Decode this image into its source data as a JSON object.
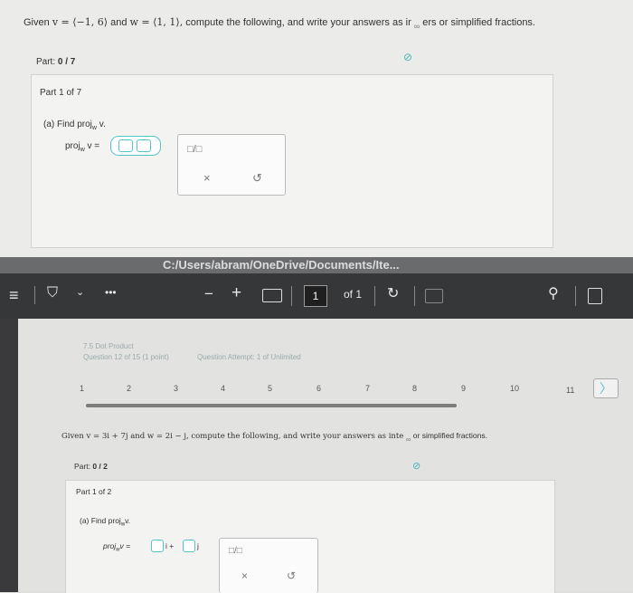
{
  "top": {
    "question_pre": "Given",
    "question_v": "v = ⟨−1, 6⟩",
    "question_and": "and",
    "question_w": "w = ⟨1, 1⟩,",
    "question_post": "compute the following, and write your answers as ir",
    "question_tail": "ers or simplified fractions.",
    "infinity": "∞",
    "part_label": "Part:",
    "part_value": "0 / 7",
    "part_of": "Part 1 of 7",
    "sub_a": "(a) Find proj",
    "sub_a_sub": "w",
    "sub_a_end": " v.",
    "proj_label": "proj",
    "proj_sub": "w",
    "proj_end": " v =",
    "frac_symbol": "□/□",
    "x_symbol": "×",
    "undo_symbol": "↺"
  },
  "band_text": "C:/Users/abram/OneDrive/Documents/Ite...",
  "toolbar": {
    "menu_icon": "≡",
    "minus": "−",
    "plus": "+",
    "page_current": "1",
    "page_of": "of 1",
    "dots": "•••"
  },
  "lower": {
    "crumb_title": "7.5 Dot Product",
    "crumb_question": "Question 12 of 15 (1 point)",
    "crumb_attempt": "Question Attempt: 1 of Unlimited",
    "pages": [
      "1",
      "2",
      "3",
      "4",
      "5",
      "6",
      "7",
      "8",
      "9",
      "10",
      "11"
    ],
    "question": "Given v = 3i + 7j and w = 2i − j, compute the following, and write your answers as inte",
    "question_tail": "or simplified fractions.",
    "part_label": "Part:",
    "part_value": "0 / 2",
    "part_of": "Part 1 of 2",
    "sub_a": "(a) Find proj",
    "sub_a_sub": "w",
    "sub_a_end": "v.",
    "proj_label": "proj",
    "proj_sub": "w",
    "proj_end": "v =",
    "i_unit": "i +",
    "j_unit": "j"
  },
  "colors": {
    "accent": "#55c4c9",
    "toolbar": "#363738"
  }
}
